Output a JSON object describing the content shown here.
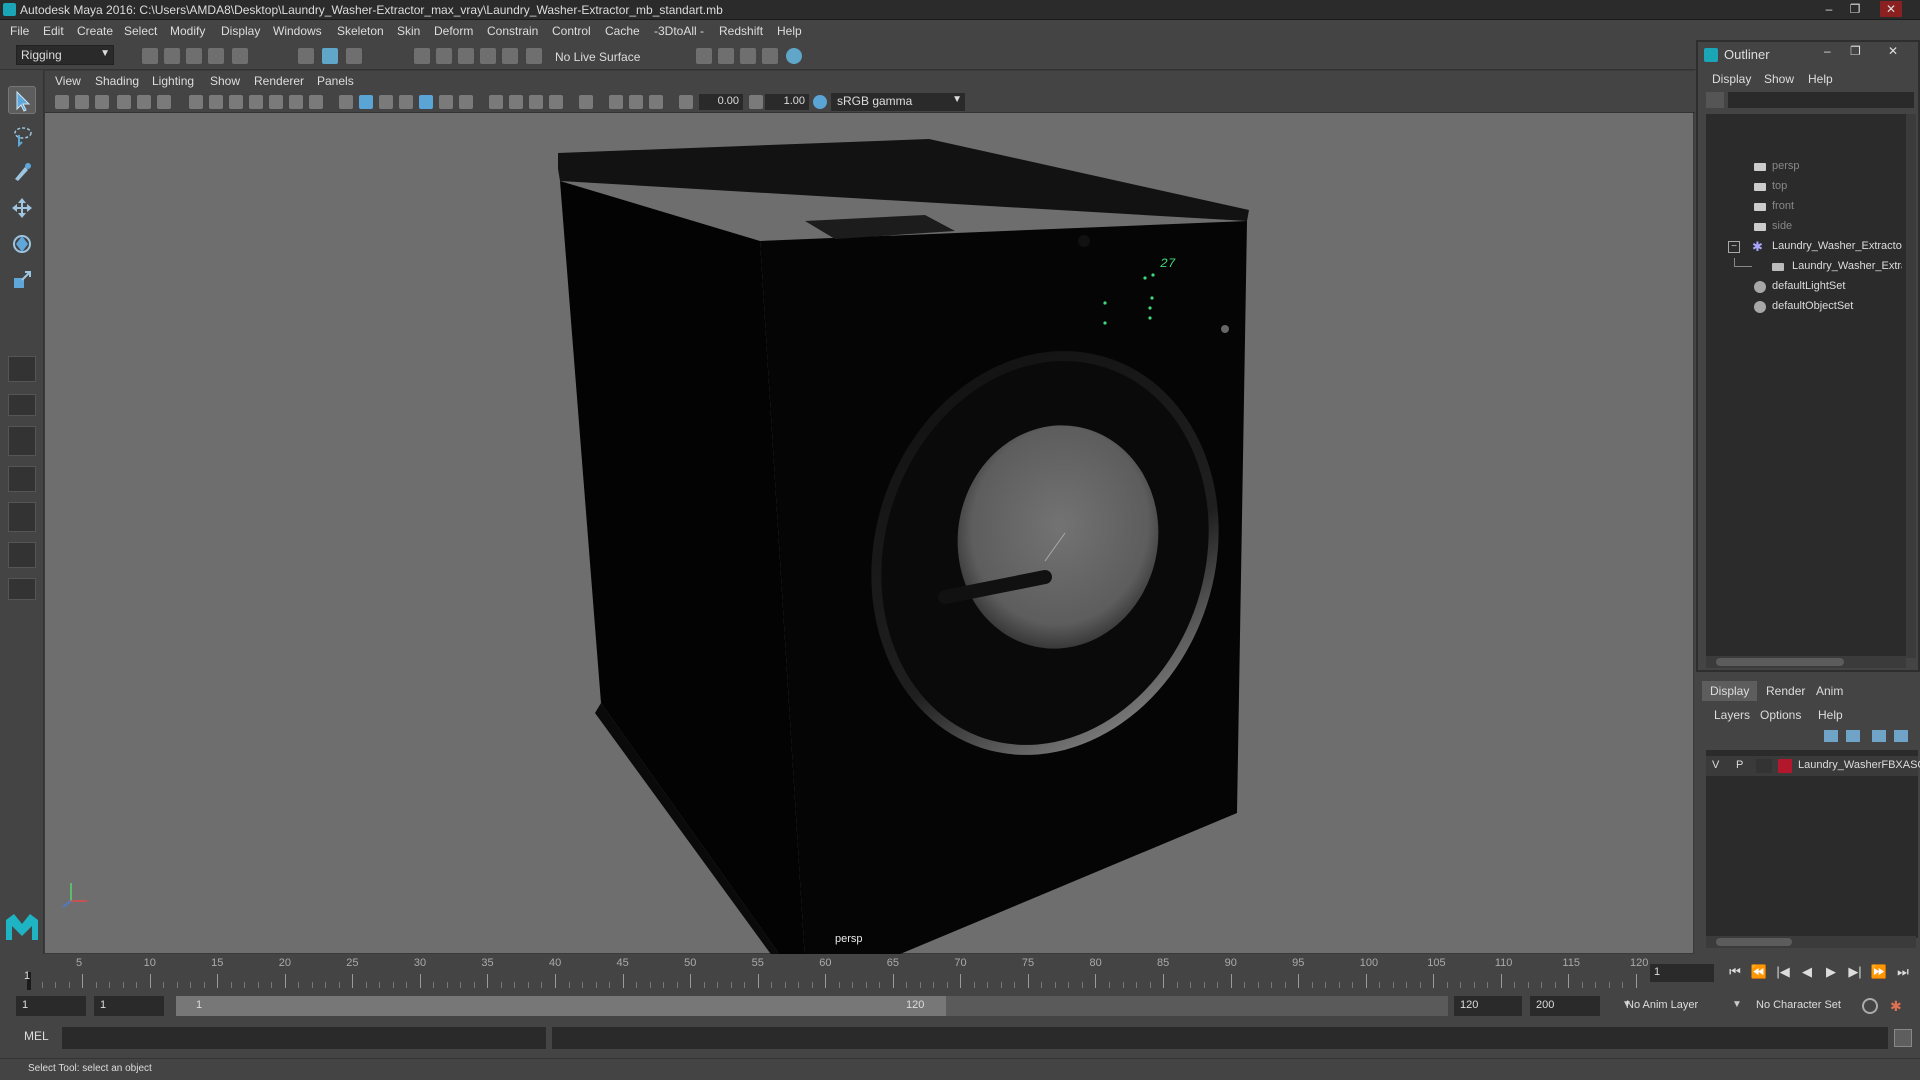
{
  "window": {
    "title": "Autodesk Maya 2016: C:\\Users\\AMDA8\\Desktop\\Laundry_Washer-Extractor_max_vray\\Laundry_Washer-Extractor_mb_standart.mb",
    "minimize": "‒",
    "maximize": "❐",
    "close": "✕"
  },
  "menubar": [
    "File",
    "Edit",
    "Create",
    "Select",
    "Modify",
    "Display",
    "Windows",
    "Skeleton",
    "Skin",
    "Deform",
    "Constrain",
    "Control",
    "Cache",
    "-3DtoAll -",
    "Redshift",
    "Help"
  ],
  "toolbar": {
    "mode": "Rigging",
    "live_surface": "No Live Surface"
  },
  "viewport": {
    "menu": [
      "View",
      "Shading",
      "Lighting",
      "Show",
      "Renderer",
      "Panels"
    ],
    "exposure": "0.00",
    "gamma_value": "1.00",
    "color_space": "sRGB gamma",
    "camera_label": "persp",
    "display_readout": "27"
  },
  "outliner": {
    "title": "Outliner",
    "menu": [
      "Display",
      "Show",
      "Help"
    ],
    "items": [
      {
        "label": "persp",
        "icon": "camera-icon",
        "dim": true
      },
      {
        "label": "top",
        "icon": "camera-icon",
        "dim": true
      },
      {
        "label": "front",
        "icon": "camera-icon",
        "dim": true
      },
      {
        "label": "side",
        "icon": "camera-icon",
        "dim": true
      },
      {
        "label": "Laundry_Washer_Extractor",
        "icon": "group-icon",
        "expanded": true
      },
      {
        "label": "Laundry_Washer_Extractor",
        "icon": "mesh-icon",
        "child": true
      },
      {
        "label": "defaultLightSet",
        "icon": "set-icon"
      },
      {
        "label": "defaultObjectSet",
        "icon": "set-icon"
      }
    ]
  },
  "layer_editor": {
    "tabs": [
      "Display",
      "Render",
      "Anim"
    ],
    "active_tab": "Display",
    "menu": [
      "Layers",
      "Options",
      "Help"
    ],
    "layers": [
      {
        "visible": "V",
        "playback": "P",
        "name": "Laundry_WasherFBXASC",
        "color": "#b3172c"
      }
    ]
  },
  "timeline": {
    "ticks": [
      5,
      10,
      15,
      20,
      25,
      30,
      35,
      40,
      45,
      50,
      55,
      60,
      65,
      70,
      75,
      80,
      85,
      90,
      95,
      100,
      105,
      110,
      115,
      120
    ],
    "first_label": "1",
    "current_frame": "1",
    "playback_buttons": [
      "⏮",
      "⏪",
      "|◀",
      "◀",
      "▶",
      "▶|",
      "⏩",
      "⏭"
    ]
  },
  "range": {
    "start_frame": "1",
    "playback_start": "1",
    "slider_start": "1",
    "slider_end": "120",
    "playback_end": "120",
    "end_frame": "200",
    "anim_layer": "No Anim Layer",
    "character_set": "No Character Set"
  },
  "cmdline": {
    "language": "MEL"
  },
  "helpline": {
    "text": "Select Tool: select an object"
  }
}
